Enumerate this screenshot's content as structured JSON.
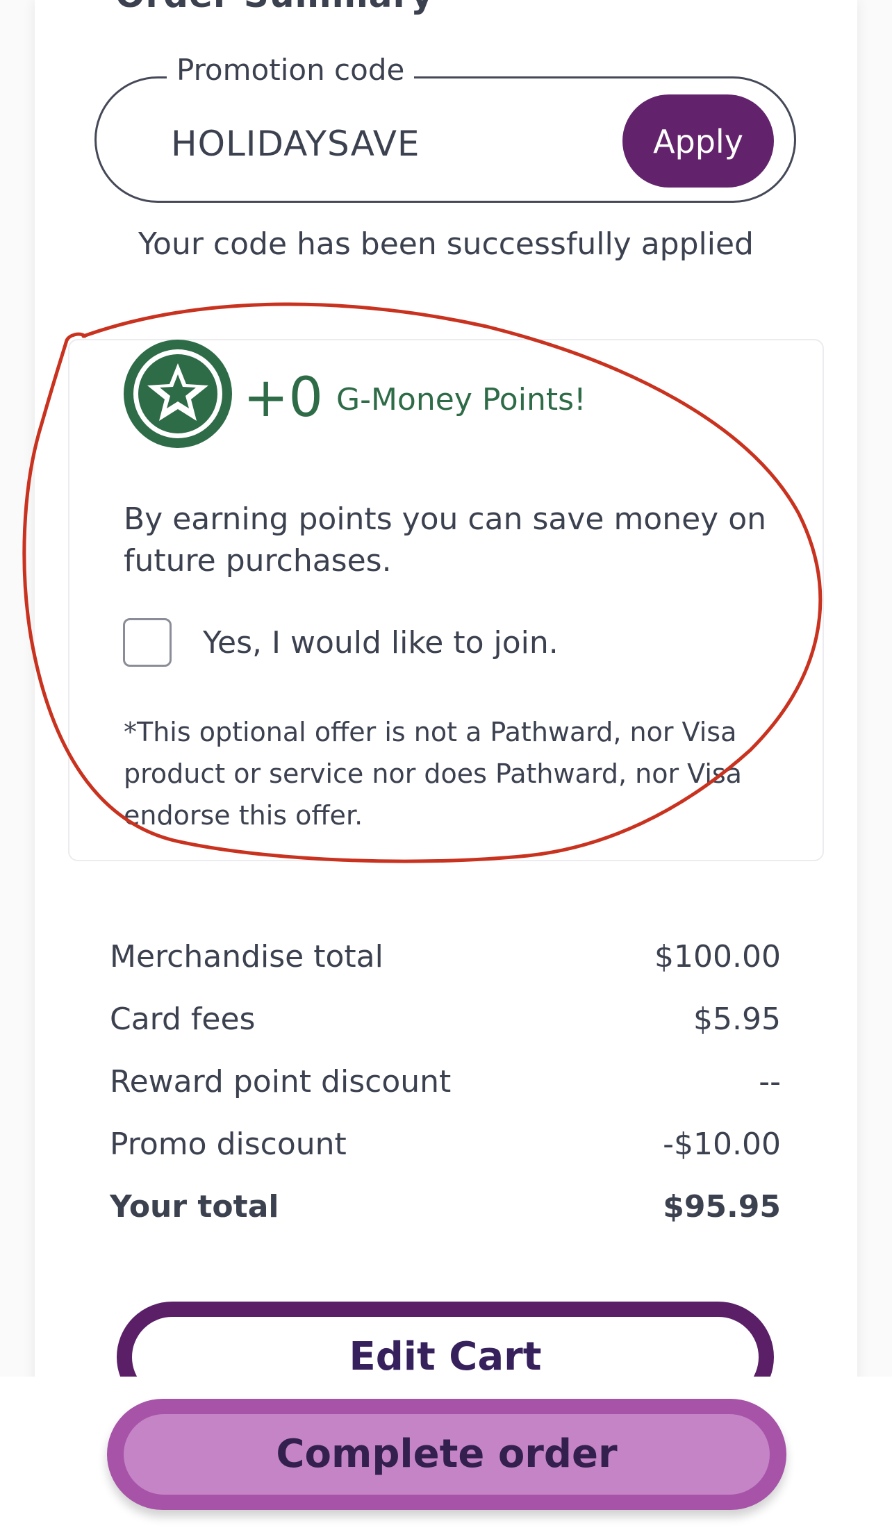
{
  "order_summary": {
    "title": "Order Summary"
  },
  "promo": {
    "legend": "Promotion code",
    "value": "HOLIDAYSAVE",
    "apply_label": "Apply",
    "success_message": "Your code has been successfully applied"
  },
  "rewards": {
    "points_value": "+0",
    "points_label": "G-Money Points!",
    "description": "By earning points you can save money on future purchases.",
    "join_label": "Yes, I would like to join.",
    "join_checked": false,
    "disclaimer": "*This optional offer is not a Pathward, nor Visa product or service nor does Pathward, nor Visa endorse this offer.",
    "badge_icon": "star-icon",
    "accent_color": "#2e6b47"
  },
  "summary": {
    "rows": [
      {
        "label": "Merchandise total",
        "value": "$100.00"
      },
      {
        "label": "Card fees",
        "value": "$5.95"
      },
      {
        "label": "Reward point discount",
        "value": "--"
      },
      {
        "label": "Promo discount",
        "value": "-$10.00"
      }
    ],
    "total_label": "Your total",
    "total_value": "$95.95"
  },
  "actions": {
    "edit_cart_label": "Edit Cart",
    "complete_order_label": "Complete order"
  },
  "colors": {
    "brand_purple": "#62236c",
    "cta_purple": "#c584c6",
    "annotation_red": "#c8321f"
  }
}
